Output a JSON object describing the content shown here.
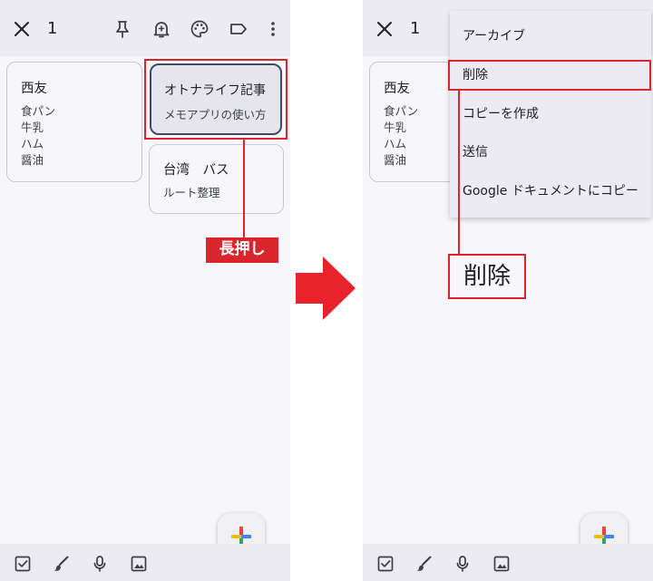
{
  "left_screen": {
    "topbar": {
      "close_icon": "close-icon",
      "selected_count": "1",
      "icons": [
        "pin-icon",
        "reminder-bell-icon",
        "palette-icon",
        "label-icon",
        "more-vert-icon"
      ]
    },
    "notes": [
      {
        "title": "西友",
        "lines": [
          "食パン",
          "牛乳",
          "ハム",
          "醤油"
        ]
      },
      {
        "title": "オトナライフ記事",
        "lines": [
          "メモアプリの使い方"
        ],
        "selected": true
      },
      {
        "title": "台湾　バス",
        "lines": [
          "ルート整理"
        ]
      }
    ],
    "callout_label": "長押し",
    "fab_icon": "plus-icon",
    "bottombar_icons": [
      "checkbox-icon",
      "brush-icon",
      "mic-icon",
      "image-icon"
    ]
  },
  "right_screen": {
    "topbar": {
      "close_icon": "close-icon",
      "selected_count": "1"
    },
    "notes": [
      {
        "title": "西友",
        "lines": [
          "食パン",
          "牛乳",
          "ハム",
          "醤油"
        ]
      }
    ],
    "menu": {
      "items": [
        "アーカイブ",
        "削除",
        "コピーを作成",
        "送信",
        "Google ドキュメントにコピー"
      ],
      "highlighted": "削除"
    },
    "zoom_label": "削除",
    "fab_icon": "plus-icon",
    "bottombar_icons": [
      "checkbox-icon",
      "brush-icon",
      "mic-icon",
      "image-icon"
    ]
  },
  "colors": {
    "callout_red": "#d9262c",
    "selected_border": "#3f4a63",
    "bar_background": "#ecebf3",
    "plus_blue": "#4285f4",
    "plus_red": "#ea4335",
    "plus_yellow": "#fbbc05",
    "plus_green": "#34a853"
  }
}
